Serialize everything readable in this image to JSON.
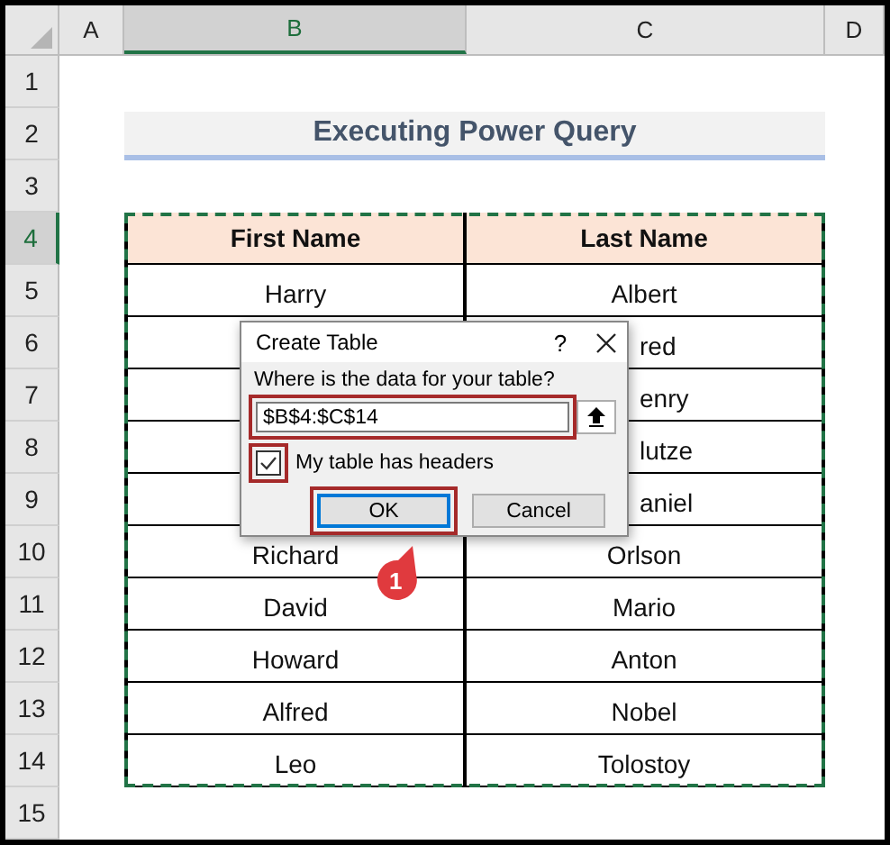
{
  "columns": [
    {
      "label": "A",
      "selected": false
    },
    {
      "label": "B",
      "selected": true
    },
    {
      "label": "C",
      "selected": false
    },
    {
      "label": "D",
      "selected": false
    }
  ],
  "row_numbers": [
    {
      "label": "1",
      "selected": false
    },
    {
      "label": "2",
      "selected": false
    },
    {
      "label": "3",
      "selected": false
    },
    {
      "label": "4",
      "selected": true
    },
    {
      "label": "5",
      "selected": false
    },
    {
      "label": "6",
      "selected": false
    },
    {
      "label": "7",
      "selected": false
    },
    {
      "label": "8",
      "selected": false
    },
    {
      "label": "9",
      "selected": false
    },
    {
      "label": "10",
      "selected": false
    },
    {
      "label": "11",
      "selected": false
    },
    {
      "label": "12",
      "selected": false
    },
    {
      "label": "13",
      "selected": false
    },
    {
      "label": "14",
      "selected": false
    },
    {
      "label": "15",
      "selected": false
    }
  ],
  "title": "Executing Power Query",
  "table": {
    "headers": [
      "First Name",
      "Last Name"
    ],
    "rows": [
      {
        "first_name": "Harry",
        "last_name": "Albert",
        "cut_by_dialog": false
      },
      {
        "last_name": "red",
        "cut_by_dialog": true
      },
      {
        "last_name": "enry",
        "cut_by_dialog": true
      },
      {
        "last_name": "lutze",
        "cut_by_dialog": true
      },
      {
        "last_name": "aniel",
        "cut_by_dialog": true
      },
      {
        "first_name": "Richard",
        "last_name": "Orlson",
        "cut_by_dialog": false
      },
      {
        "first_name": "David",
        "last_name": "Mario",
        "cut_by_dialog": false
      },
      {
        "first_name": "Howard",
        "last_name": "Anton",
        "cut_by_dialog": false
      },
      {
        "first_name": "Alfred",
        "last_name": "Nobel",
        "cut_by_dialog": false
      },
      {
        "first_name": "Leo",
        "last_name": "Tolostoy",
        "cut_by_dialog": false
      }
    ]
  },
  "dialog": {
    "title": "Create Table",
    "help": "?",
    "prompt": "Where is the data for your table?",
    "range": {
      "value": "$B$4:$C$14",
      "highlighted": true
    },
    "has_headers": {
      "label": "My table has headers",
      "checked": true,
      "highlighted": true
    },
    "buttons": [
      {
        "label": "OK",
        "selected": true,
        "highlighted": true
      },
      {
        "label": "Cancel",
        "selected": false
      }
    ]
  },
  "callout": {
    "label": "1"
  }
}
